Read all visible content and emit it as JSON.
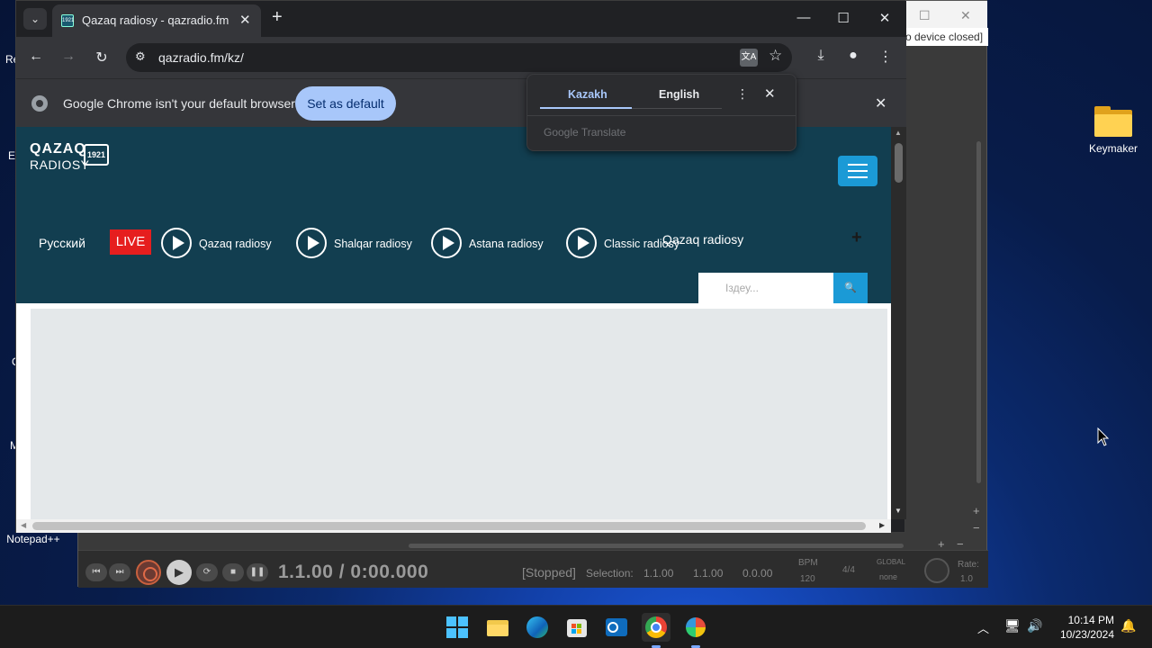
{
  "desktop": {
    "icons": [
      {
        "label": "Keymaker"
      },
      {
        "label": "Notepad++"
      }
    ],
    "edge_fragments": [
      "Re",
      "Ev",
      "O",
      "M"
    ]
  },
  "daw": {
    "status_text": "o device closed]",
    "time_display": "1.1.00 / 0:00.000",
    "stopped": "[Stopped]",
    "selection_label": "Selection:",
    "selection_start": "1.1.00",
    "selection_end": "1.1.00",
    "selection_len": "0.0.00",
    "bpm_label": "BPM",
    "bpm_value": "120",
    "time_sig": "4/4",
    "global_label": "GLOBAL",
    "global_value": "none",
    "rate_label": "Rate:",
    "rate_value": "1.0"
  },
  "browser": {
    "tab_title": "Qazaq radiosy - qazradio.fm | K",
    "favicon_text": "1921",
    "url": "qazradio.fm/kz/",
    "infobar_text": "Google Chrome isn't your default browser",
    "set_default_label": "Set as default",
    "translate": {
      "source_lang": "Kazakh",
      "target_lang": "English",
      "brand": "Google Translate"
    }
  },
  "site": {
    "logo_line1": "QAZAQ",
    "logo_line2": "RADIOSY",
    "logo_badge": "1921",
    "lang_link": "Русский",
    "live_badge": "LIVE",
    "stations": [
      {
        "name": "Qazaq radiosy"
      },
      {
        "name": "Shalqar radiosy"
      },
      {
        "name": "Astana radiosy"
      },
      {
        "name": "Classic radiosy"
      }
    ],
    "now_playing": "Qazaq radiosy",
    "search_placeholder": "Іздеу...",
    "colors": {
      "header_bg": "#123e50",
      "accent": "#1b9ad6",
      "live": "#e61e1e"
    }
  },
  "taskbar": {
    "apps": [
      "start-icon",
      "file-explorer-icon",
      "edge-icon",
      "store-icon",
      "outlook-icon",
      "chrome-icon",
      "app-icon"
    ],
    "time": "10:14 PM",
    "date": "10/23/2024"
  }
}
